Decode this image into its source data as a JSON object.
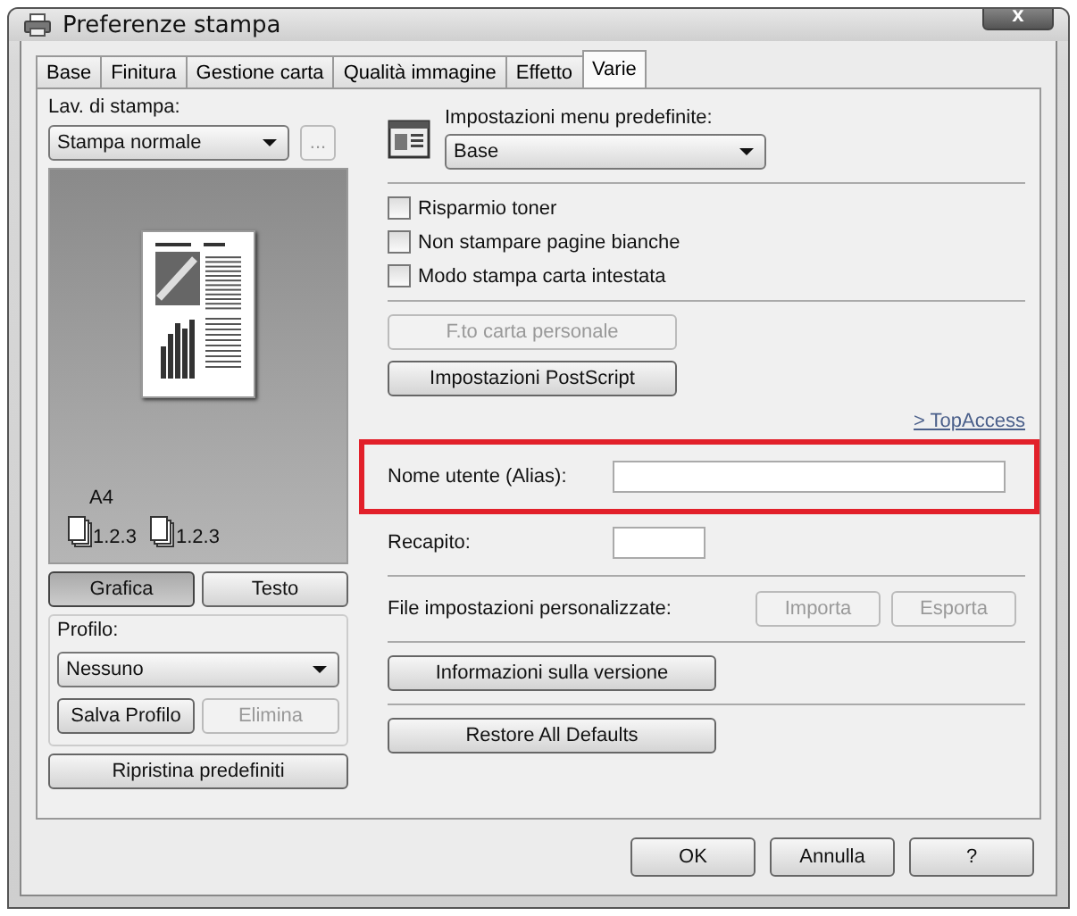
{
  "window": {
    "title": "Preferenze stampa",
    "close": "x"
  },
  "tabs": [
    {
      "label": "Base",
      "selected": false
    },
    {
      "label": "Finitura",
      "selected": false
    },
    {
      "label": "Gestione carta",
      "selected": false
    },
    {
      "label": "Qualità immagine",
      "selected": false
    },
    {
      "label": "Effetto",
      "selected": false
    },
    {
      "label": "Varie",
      "selected": true
    }
  ],
  "left": {
    "job_label": "Lav. di stampa:",
    "job_select": "Stampa normale",
    "more_button": "...",
    "preview": {
      "paper": "A4",
      "stacks": [
        "1.2.3",
        "1.2.3"
      ]
    },
    "view_toggle": [
      {
        "label": "Grafica",
        "selected": true
      },
      {
        "label": "Testo",
        "selected": false
      }
    ],
    "profile": {
      "label": "Profilo:",
      "select": "Nessuno",
      "buttons": [
        {
          "label": "Salva Profilo",
          "disabled": false
        },
        {
          "label": "Elimina",
          "disabled": true
        }
      ]
    },
    "restore_button": "Ripristina predefiniti"
  },
  "right": {
    "menu_label": "Impostazioni menu predefinite:",
    "menu_select": "Base",
    "checkboxes": [
      {
        "label": "Risparmio toner",
        "checked": false
      },
      {
        "label": "Non stampare pagine bianche",
        "checked": false
      },
      {
        "label": "Modo stampa carta intestata",
        "checked": false
      }
    ],
    "buttons": [
      {
        "label": "F.to carta personale",
        "disabled": true
      },
      {
        "label": "Impostazioni PostScript",
        "disabled": false
      }
    ],
    "link": "> TopAccess",
    "username": {
      "label": "Nome utente (Alias):"
    },
    "department": {
      "label": "Recapito:"
    },
    "custom_file": {
      "label": "File impostazioni personalizzate:",
      "buttons": [
        {
          "label": "Importa",
          "disabled": true
        },
        {
          "label": "Esporta",
          "disabled": true
        }
      ]
    },
    "version_button": "Informazioni sulla versione",
    "restore_all_button": "Restore All Defaults"
  },
  "footer": [
    "OK",
    "Annulla",
    "?"
  ]
}
